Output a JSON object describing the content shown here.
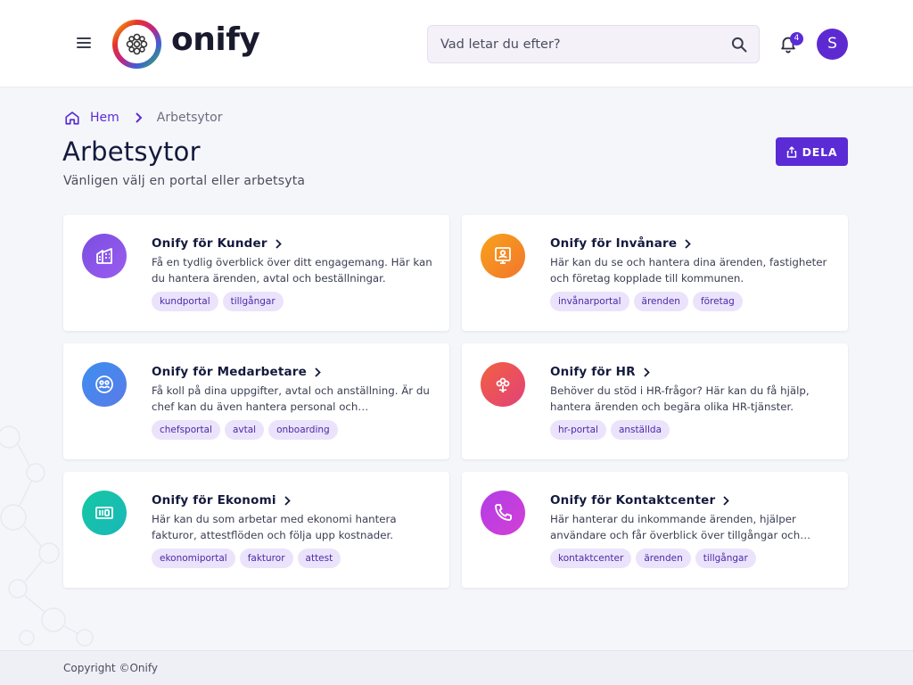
{
  "header": {
    "logo_text": "onify",
    "search_placeholder": "Vad letar du efter?",
    "notification_count": "4",
    "avatar_initial": "S"
  },
  "breadcrumb": {
    "home": "Hem",
    "current": "Arbetsytor"
  },
  "page": {
    "title": "Arbetsytor",
    "subtitle": "Vänligen välj en portal eller arbetsyta",
    "share_label": "DELA"
  },
  "cards": [
    {
      "title": "Onify för Kunder",
      "description": "Få en tydlig överblick över ditt engagemang. Här kan du hantera ärenden, avtal och beställningar.",
      "tags": [
        "kundportal",
        "tillgångar"
      ],
      "icon": "building-icon",
      "gradient_from": "#7b4ee0",
      "gradient_to": "#9a5cf0"
    },
    {
      "title": "Onify för Invånare",
      "description": "Här kan du se och hantera dina ärenden, fastigheter och företag kopplade till kommunen.",
      "tags": [
        "invånarportal",
        "ärenden",
        "företag"
      ],
      "icon": "person-board-icon",
      "gradient_from": "#f7a21b",
      "gradient_to": "#f2762d"
    },
    {
      "title": "Onify för Medarbetare",
      "description": "Få koll på dina uppgifter, avtal och anställning. Är du chef kan du även hantera personal och on-/offboarding.",
      "tags": [
        "chefsportal",
        "avtal",
        "onboarding"
      ],
      "icon": "people-circle-icon",
      "gradient_from": "#3d8ef0",
      "gradient_to": "#5a7be8"
    },
    {
      "title": "Onify för HR",
      "description": "Behöver du stöd i HR-frågor? Här kan du få hjälp, hantera ärenden och begära olika HR-tjänster.",
      "tags": [
        "hr-portal",
        "anställda"
      ],
      "icon": "flower-icon",
      "gradient_from": "#f2603f",
      "gradient_to": "#e2427a"
    },
    {
      "title": "Onify för Ekonomi",
      "description": "Här kan du som arbetar med ekonomi hantera fakturor, attestflöden och följa upp kostnader.",
      "tags": [
        "ekonomiportal",
        "fakturor",
        "attest"
      ],
      "icon": "money-icon",
      "gradient_from": "#16c7a4",
      "gradient_to": "#18b8b8"
    },
    {
      "title": "Onify för Kontaktcenter",
      "description": "Här hanterar du inkommande ärenden, hjälper användare och får överblick över tillgångar och resurser.",
      "tags": [
        "kontaktcenter",
        "ärenden",
        "tillgångar"
      ],
      "icon": "phone-icon",
      "gradient_from": "#b23ee6",
      "gradient_to": "#d23fd6"
    }
  ],
  "footer": {
    "copyright": "Copyright ©Onify"
  },
  "colors": {
    "accent": "#5b2bd6",
    "tag_bg": "#ebe3fb",
    "tag_text": "#4a2aa6"
  }
}
